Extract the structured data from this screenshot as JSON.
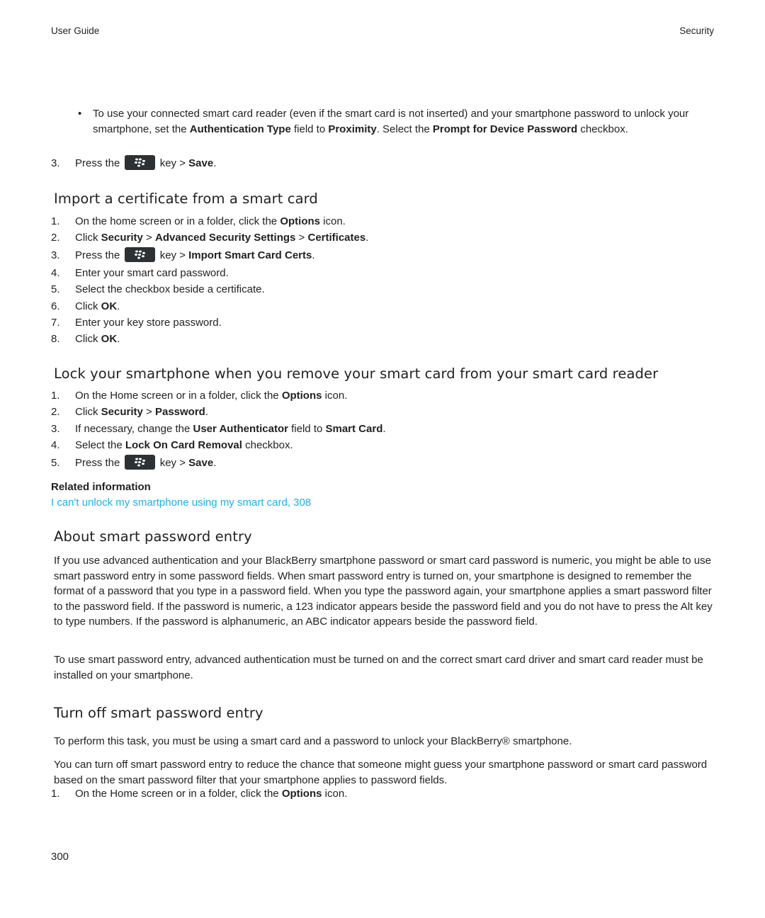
{
  "header": {
    "left": "User Guide",
    "right": "Security"
  },
  "intro": {
    "bullet": {
      "t1": "To use your connected smart card reader (even if the smart card is not inserted) and your smartphone password to unlock your smartphone, set the ",
      "b1": "Authentication Type",
      "t2": " field to ",
      "b2": "Proximity",
      "t3": ". Select the ",
      "b3": "Prompt for Device Password",
      "t4": " checkbox."
    },
    "step3": {
      "num": "3.",
      "pre": "Press the ",
      "mid": " key > ",
      "bold": "Save",
      "post": "."
    }
  },
  "import_section": {
    "title": "Import a certificate from a smart card",
    "steps": [
      {
        "num": "1.",
        "t1": "On the home screen or in a folder, click the ",
        "b1": "Options",
        "t2": " icon."
      },
      {
        "num": "2.",
        "t1": "Click ",
        "b1": "Security",
        "t2": " > ",
        "b2": "Advanced Security Settings",
        "t3": " > ",
        "b3": "Certificates",
        "t4": "."
      },
      {
        "num": "3.",
        "pre": "Press the ",
        "mid": " key > ",
        "bold": "Import Smart Card Certs",
        "post": "."
      },
      {
        "num": "4.",
        "text": "Enter your smart card password."
      },
      {
        "num": "5.",
        "text": "Select the checkbox beside a certificate."
      },
      {
        "num": "6.",
        "t1": "Click ",
        "b1": "OK",
        "t2": "."
      },
      {
        "num": "7.",
        "text": "Enter your key store password."
      },
      {
        "num": "8.",
        "t1": "Click ",
        "b1": "OK",
        "t2": "."
      }
    ]
  },
  "lock_section": {
    "title": "Lock your smartphone when you remove your smart card from your smart card reader",
    "steps": [
      {
        "num": "1.",
        "t1": "On the Home screen or in a folder, click the ",
        "b1": "Options",
        "t2": " icon."
      },
      {
        "num": "2.",
        "t1": "Click ",
        "b1": "Security",
        "t2": " > ",
        "b2": "Password",
        "t3": "."
      },
      {
        "num": "3.",
        "t1": "If necessary, change the ",
        "b1": "User Authenticator",
        "t2": " field to ",
        "b2": "Smart Card",
        "t3": "."
      },
      {
        "num": "4.",
        "t1": "Select the ",
        "b1": "Lock On Card Removal",
        "t2": " checkbox."
      },
      {
        "num": "5.",
        "pre": "Press the ",
        "mid": " key > ",
        "bold": "Save",
        "post": "."
      }
    ],
    "related_title": "Related information",
    "related_link": "I can't unlock my smartphone using my smart card, 308"
  },
  "about_section": {
    "title": "About smart password entry",
    "p1": "If you use advanced authentication and your BlackBerry smartphone password or smart card password is numeric, you might be able to use smart password entry in some password fields. When smart password entry is turned on, your smartphone is designed to remember the format of a password that you type in a password field. When you type the password again, your smartphone applies a smart password filter to the password field. If the password is numeric, a 123 indicator appears beside the password field and you do not have to press the Alt key to type numbers. If the password is alphanumeric, an ABC indicator appears beside the password field.",
    "p2": "To use smart password entry, advanced authentication must be turned on and the correct smart card driver and smart card reader must be installed on your smartphone."
  },
  "turnoff_section": {
    "title": "Turn off smart password entry",
    "p1": "To perform this task, you must be using a smart card and a password to unlock your BlackBerry® smartphone.",
    "p2": "You can turn off smart password entry to reduce the chance that someone might guess your smartphone password or smart card password based on the smart password filter that your smartphone applies to password fields.",
    "step1": {
      "num": "1.",
      "t1": "On the Home screen or in a folder, click the ",
      "b1": "Options",
      "t2": " icon."
    }
  },
  "footer": {
    "page_number": "300"
  },
  "icons": {
    "menu_key": "blackberry-menu-key-icon"
  },
  "colors": {
    "link": "#1fb0e6",
    "key_bg": "#2d3133",
    "text": "#231f20"
  }
}
